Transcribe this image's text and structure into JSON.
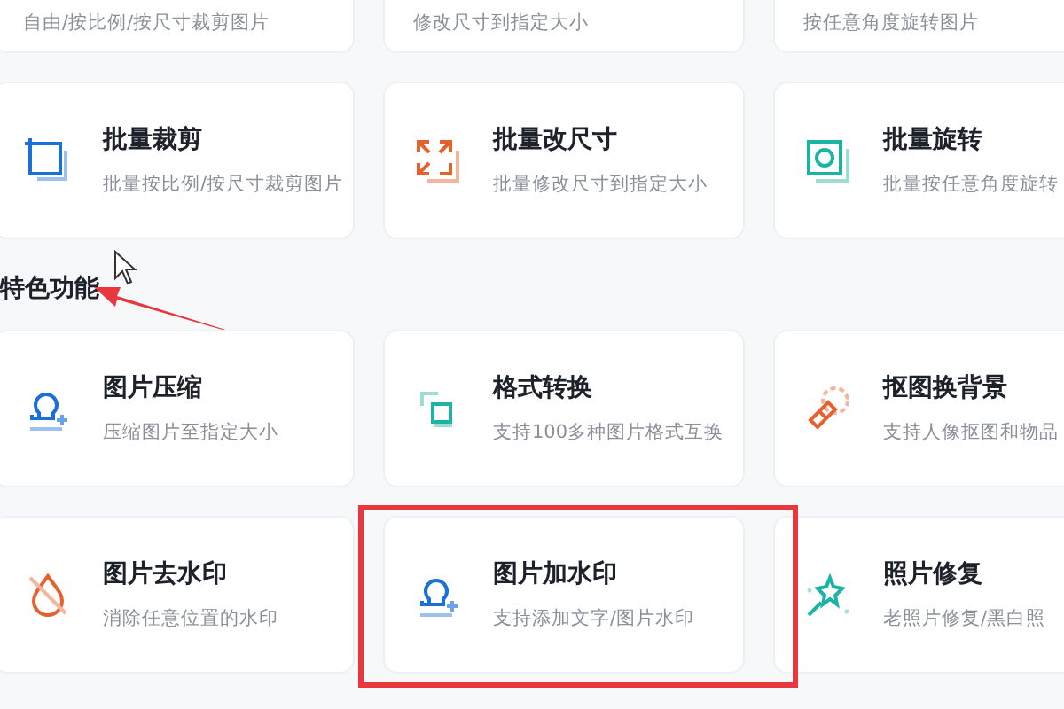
{
  "groups": [
    {
      "cards": [
        {
          "subtitle": "自由/按比例/按尺寸裁剪图片",
          "highlighted": false
        },
        {
          "subtitle": "修改尺寸到指定大小",
          "highlighted": false
        },
        {
          "subtitle": "按任意角度旋转图片",
          "highlighted": false
        },
        {
          "title": "批量裁剪",
          "subtitle": "批量按比例/按尺寸裁剪图片",
          "highlighted": false
        },
        {
          "title": "批量改尺寸",
          "subtitle": "批量修改尺寸到指定大小",
          "highlighted": false
        },
        {
          "title": "批量旋转",
          "subtitle": "批量按任意角度旋转",
          "highlighted": false
        }
      ]
    },
    {
      "heading": "特色功能",
      "pointer_arrow": true,
      "cards": [
        {
          "title": "图片压缩",
          "subtitle": "压缩图片至指定大小",
          "highlighted": false
        },
        {
          "title": "格式转换",
          "subtitle": "支持100多种图片格式互换",
          "highlighted": false
        },
        {
          "title": "抠图换背景",
          "subtitle": "支持人像抠图和物品",
          "highlighted": false
        },
        {
          "title": "图片去水印",
          "subtitle": "消除任意位置的水印",
          "highlighted": false
        },
        {
          "title": "图片加水印",
          "subtitle": "支持添加文字/图片水印",
          "highlighted": true
        },
        {
          "title": "照片修复",
          "subtitle": "老照片修复/黑白照",
          "highlighted": false
        }
      ]
    }
  ]
}
